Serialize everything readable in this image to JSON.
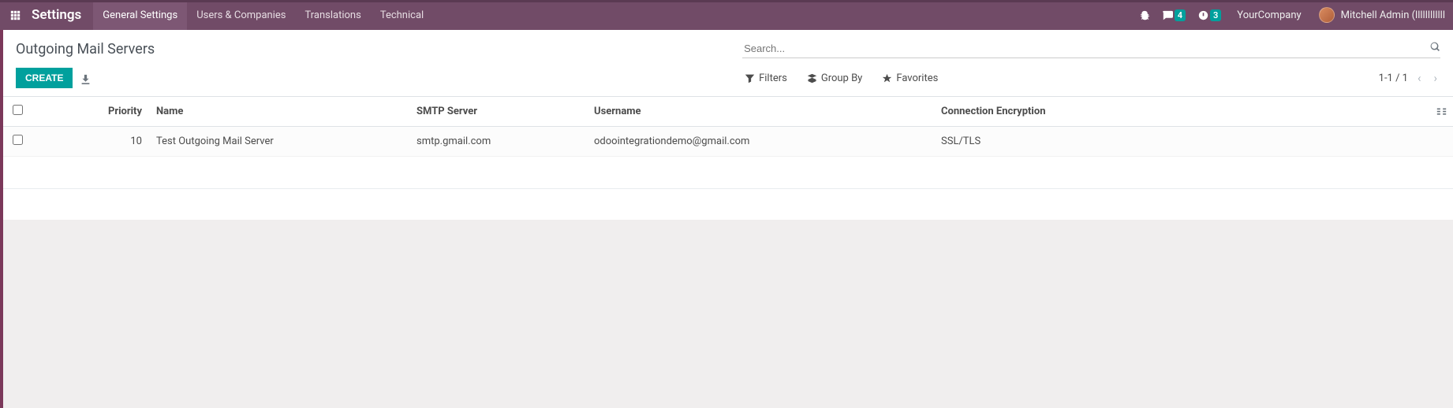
{
  "topbar": {
    "app_title": "Settings",
    "menu": [
      {
        "label": "General Settings",
        "active": true
      },
      {
        "label": "Users & Companies",
        "active": false
      },
      {
        "label": "Translations",
        "active": false
      },
      {
        "label": "Technical",
        "active": false
      }
    ],
    "messages_badge": "4",
    "activities_badge": "3",
    "company": "YourCompany",
    "user": "Mitchell Admin (llllllllllll"
  },
  "control": {
    "page_title": "Outgoing Mail Servers",
    "create_label": "CREATE",
    "search_placeholder": "Search...",
    "filters_label": "Filters",
    "groupby_label": "Group By",
    "favorites_label": "Favorites",
    "pager_text": "1-1 / 1"
  },
  "table": {
    "headers": {
      "priority": "Priority",
      "name": "Name",
      "smtp": "SMTP Server",
      "username": "Username",
      "encryption": "Connection Encryption"
    },
    "rows": [
      {
        "priority": "10",
        "name": "Test Outgoing Mail Server",
        "smtp": "smtp.gmail.com",
        "username": "odoointegrationdemo@gmail.com",
        "encryption": "SSL/TLS"
      }
    ]
  }
}
